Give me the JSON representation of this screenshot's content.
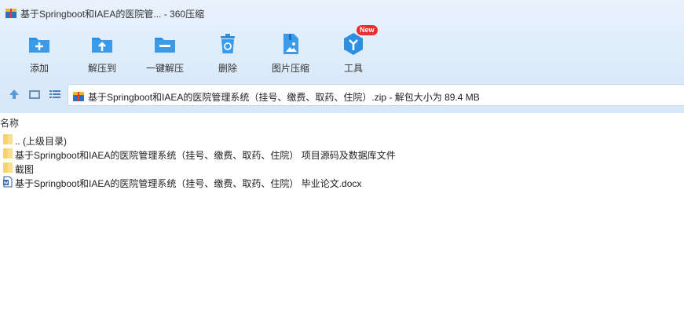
{
  "window": {
    "title": "基于Springboot和IAEA的医院管... - 360压缩"
  },
  "toolbar": {
    "items": [
      {
        "label": "添加",
        "icon": "add-icon"
      },
      {
        "label": "解压到",
        "icon": "extract-to-icon"
      },
      {
        "label": "一键解压",
        "icon": "one-click-extract-icon"
      },
      {
        "label": "删除",
        "icon": "delete-icon"
      },
      {
        "label": "图片压缩",
        "icon": "image-compress-icon"
      },
      {
        "label": "工具",
        "icon": "tools-icon",
        "badge": "New"
      }
    ],
    "accent_color": "#2d8fe0",
    "badge_color": "#e8312c"
  },
  "nav": {
    "address": "基于Springboot和IAEA的医院管理系统（挂号、缴费、取药、住院）.zip - 解包大小为 89.4 MB"
  },
  "list": {
    "column_name": "名称",
    "items": [
      {
        "name": ".. (上级目录)",
        "type": "folder"
      },
      {
        "name": "基于Springboot和IAEA的医院管理系统（挂号、缴费、取药、住院） 项目源码及数据库文件",
        "type": "folder"
      },
      {
        "name": "截图",
        "type": "folder"
      },
      {
        "name": "基于Springboot和IAEA的医院管理系统（挂号、缴费、取药、住院） 毕业论文.docx",
        "type": "docx"
      }
    ]
  }
}
